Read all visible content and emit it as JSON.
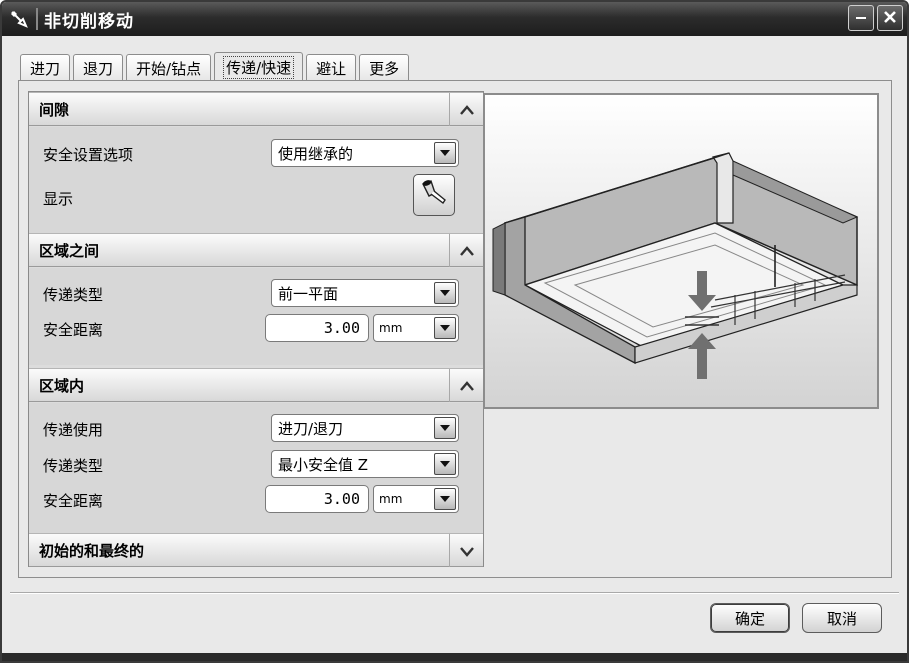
{
  "window": {
    "title": "非切削移动"
  },
  "tabs": [
    {
      "label": "进刀"
    },
    {
      "label": "退刀"
    },
    {
      "label": "开始/钻点"
    },
    {
      "label": "传递/快速"
    },
    {
      "label": "避让"
    },
    {
      "label": "更多"
    }
  ],
  "active_tab": "传递/快速",
  "sections": {
    "clearance": {
      "title": "间隙",
      "safety_option_label": "安全设置选项",
      "safety_option_value": "使用继承的",
      "display_label": "显示"
    },
    "between_regions": {
      "title": "区域之间",
      "transfer_type_label": "传递类型",
      "transfer_type_value": "前一平面",
      "safe_distance_label": "安全距离",
      "safe_distance_value": "3.00",
      "safe_distance_unit": "mm"
    },
    "within_region": {
      "title": "区域内",
      "transfer_using_label": "传递使用",
      "transfer_using_value": "进刀/退刀",
      "transfer_type_label": "传递类型",
      "transfer_type_value": "最小安全值 Z",
      "safe_distance_label": "安全距离",
      "safe_distance_value": "3.00",
      "safe_distance_unit": "mm"
    },
    "initial_final": {
      "title": "初始的和最终的"
    }
  },
  "buttons": {
    "ok": "确定",
    "cancel": "取消"
  },
  "icons": {
    "app": "wrench-icon",
    "minimize": "minimize-icon",
    "close": "close-icon",
    "collapse": "chevron-up-icon",
    "expand": "chevron-down-icon",
    "dropdown": "dropdown-arrow-icon",
    "display": "flashlight-icon"
  }
}
